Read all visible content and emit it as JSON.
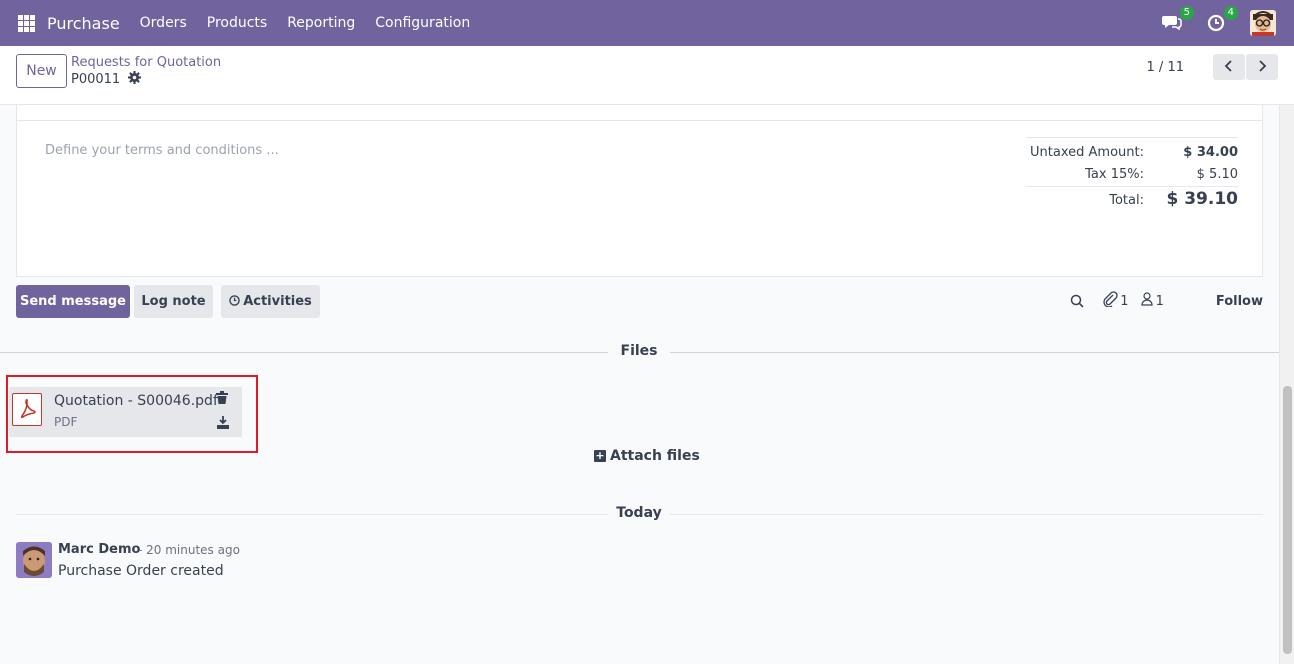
{
  "navbar": {
    "brand": "Purchase",
    "menu": [
      "Orders",
      "Products",
      "Reporting",
      "Configuration"
    ],
    "messages_count": "5",
    "activities_count": "4",
    "bg_color": "#71639e"
  },
  "control": {
    "new_label": "New",
    "breadcrumb": "Requests for Quotation",
    "record_name": "P00011",
    "pager": "1 / 11"
  },
  "form": {
    "terms_placeholder": "Define your terms and conditions ...",
    "totals": {
      "untaxed_label": "Untaxed Amount:",
      "untaxed_value": "$ 34.00",
      "tax_label": "Tax 15%:",
      "tax_value": "$ 5.10",
      "total_label": "Total:",
      "total_value": "$ 39.10"
    }
  },
  "chatter": {
    "send_message": "Send message",
    "log_note": "Log note",
    "activities": "Activities",
    "attachments_count": "1",
    "followers_count": "1",
    "follow": "Follow",
    "files_heading": "Files",
    "attachment": {
      "name": "Quotation - S00046.pdf",
      "type": "PDF"
    },
    "attach_files": "Attach files",
    "today_heading": "Today",
    "message": {
      "author": "Marc Demo",
      "time": "- 20 minutes ago",
      "body": "Purchase Order created"
    }
  },
  "icons": [
    "apps-icon",
    "chat-icon",
    "clock-icon",
    "user-avatar",
    "gear-icon",
    "chevron-left-icon",
    "chevron-right-icon",
    "search-icon",
    "paperclip-icon",
    "follower-icon",
    "pdf-icon",
    "trash-icon",
    "download-icon",
    "plus-square-icon",
    "clock-circle-icon"
  ]
}
